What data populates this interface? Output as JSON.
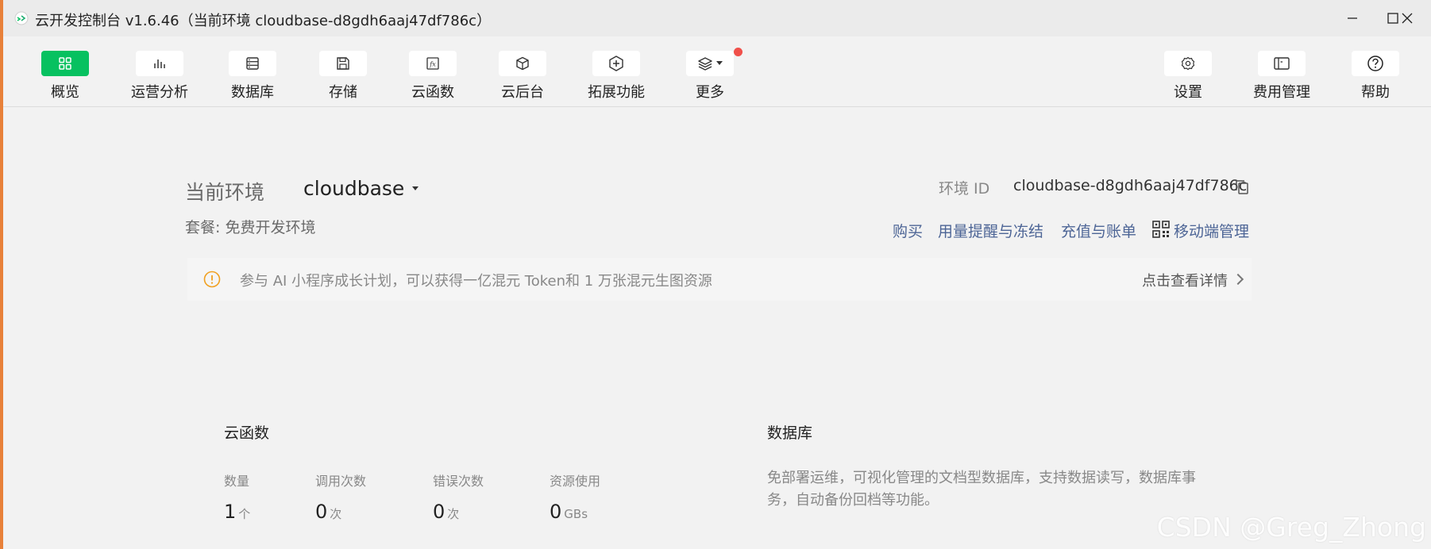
{
  "window": {
    "title": "云开发控制台 v1.6.46（当前环境 cloudbase-d8gdh6aaj47df786c）"
  },
  "toolbar": {
    "items": [
      {
        "label": "概览",
        "icon": "grid-icon",
        "active": true
      },
      {
        "label": "运营分析",
        "icon": "bar-chart-icon"
      },
      {
        "label": "数据库",
        "icon": "database-icon"
      },
      {
        "label": "存储",
        "icon": "save-icon"
      },
      {
        "label": "云函数",
        "icon": "function-icon"
      },
      {
        "label": "云后台",
        "icon": "cube-icon"
      },
      {
        "label": "拓展功能",
        "icon": "hexagon-plus-icon"
      },
      {
        "label": "更多",
        "icon": "layers-icon"
      }
    ],
    "right_items": [
      {
        "label": "设置",
        "icon": "gear-icon"
      },
      {
        "label": "费用管理",
        "icon": "panel-icon"
      },
      {
        "label": "帮助",
        "icon": "help-icon"
      }
    ]
  },
  "env": {
    "current_label": "当前环境",
    "selected": "cloudbase",
    "plan": "套餐: 免费开发环境",
    "id_label": "环境 ID",
    "id_value": "cloudbase-d8gdh6aaj47df786c"
  },
  "links": {
    "buy": "购买",
    "usage_alert": "用量提醒与冻结",
    "recharge": "充值与账单",
    "mobile": "移动端管理"
  },
  "banner": {
    "text": "参与 AI 小程序成长计划，可以获得一亿混元 Token和 1 万张混元生图资源",
    "link": "点击查看详情"
  },
  "functions": {
    "title": "云函数",
    "stats": [
      {
        "label": "数量",
        "value": "1",
        "unit": "个"
      },
      {
        "label": "调用次数",
        "value": "0",
        "unit": "次"
      },
      {
        "label": "错误次数",
        "value": "0",
        "unit": "次"
      },
      {
        "label": "资源使用",
        "value": "0",
        "unit": "GBs"
      }
    ]
  },
  "database": {
    "title": "数据库",
    "description": "免部署运维，可视化管理的文档型数据库，支持数据读写，数据库事务，自动备份回档等功能。"
  },
  "watermark": "CSDN @Greg_Zhong",
  "colors": {
    "accent": "#07c160",
    "link": "#4d6596",
    "warning": "#f0a020",
    "notification_dot": "#f0504a"
  }
}
